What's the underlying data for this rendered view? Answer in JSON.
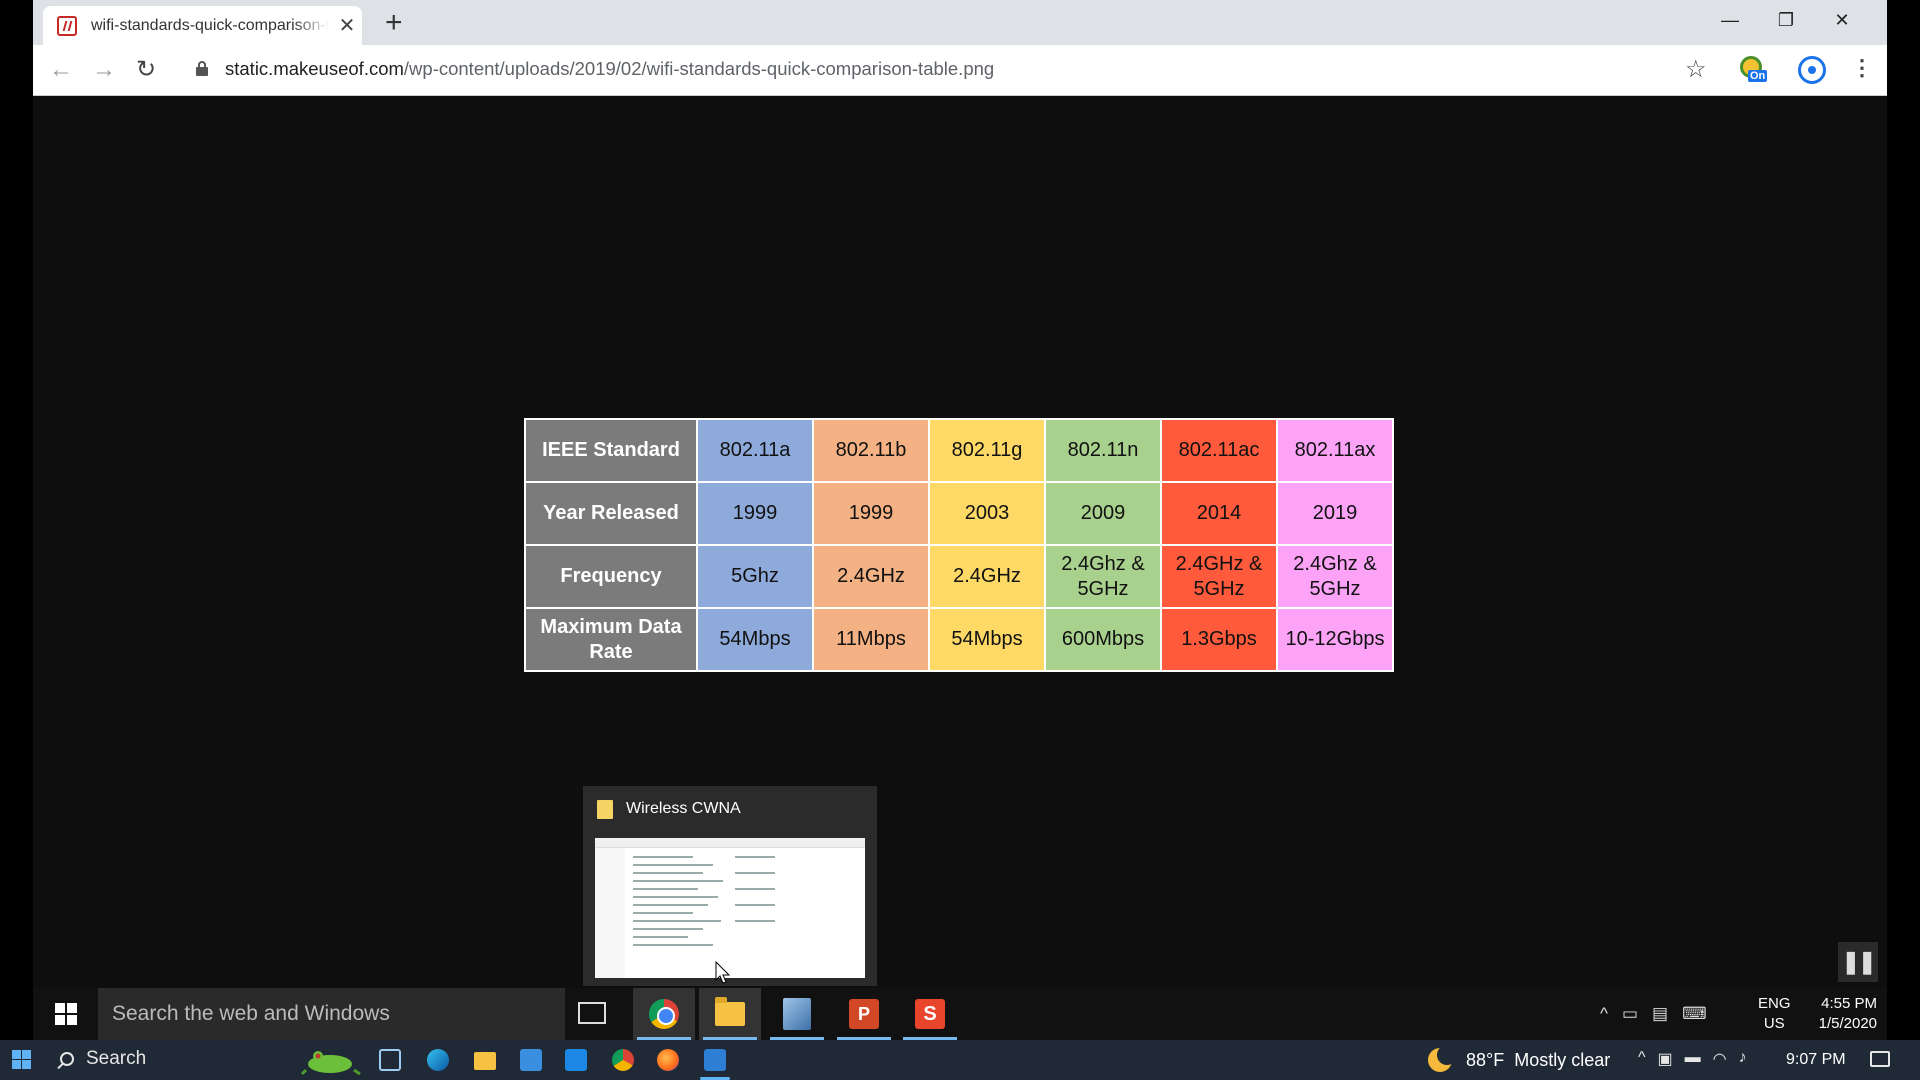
{
  "browser": {
    "tab_title": "wifi-standards-quick-comparison-table.png",
    "url_host": "static.makeuseof.com",
    "url_path": "/wp-content/uploads/2019/02/wifi-standards-quick-comparison-table.png",
    "extension_badge": "On"
  },
  "table": {
    "header_labels": [
      "IEEE Standard",
      "Year Released",
      "Frequency",
      "Maximum Data Rate"
    ],
    "columns": [
      {
        "standard": "802.11a",
        "year": "1999",
        "frequency": "5Ghz",
        "rate": "54Mbps",
        "color": "#8eaadb"
      },
      {
        "standard": "802.11b",
        "year": "1999",
        "frequency": "2.4GHz",
        "rate": "11Mbps",
        "color": "#f4b183"
      },
      {
        "standard": "802.11g",
        "year": "2003",
        "frequency": "2.4GHz",
        "rate": "54Mbps",
        "color": "#ffd966"
      },
      {
        "standard": "802.11n",
        "year": "2009",
        "frequency": "2.4Ghz & 5GHz",
        "rate": "600Mbps",
        "color": "#a9d18e"
      },
      {
        "standard": "802.11ac",
        "year": "2014",
        "frequency": "2.4GHz & 5GHz",
        "rate": "1.3Gbps",
        "color": "#ff5a3c"
      },
      {
        "standard": "802.11ax",
        "year": "2019",
        "frequency": "2.4Ghz & 5GHz",
        "rate": "10-12Gbps",
        "color": "#fda3f7"
      }
    ]
  },
  "thumbnail_popup": {
    "title": "Wireless CWNA"
  },
  "inner_taskbar": {
    "search_placeholder": "Search the web and Windows",
    "ppt_letter": "P",
    "app5_letter": "S",
    "lang": "ENG",
    "region": "US",
    "time": "4:55 PM",
    "date": "1/5/2020"
  },
  "outer_taskbar": {
    "search_label": "Search",
    "weather": "88°F",
    "weather_desc": "Mostly clear",
    "time": "9:07 PM"
  }
}
